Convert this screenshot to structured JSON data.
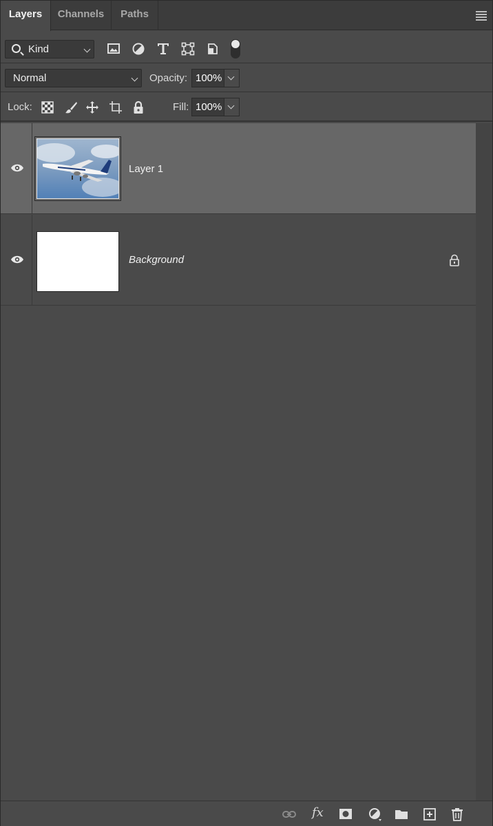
{
  "tabs": [
    {
      "label": "Layers",
      "active": true
    },
    {
      "label": "Channels",
      "active": false
    },
    {
      "label": "Paths",
      "active": false
    }
  ],
  "filter": {
    "kind_label": "Kind",
    "icons": [
      "image-filter-icon",
      "adjustment-filter-icon",
      "type-filter-icon",
      "shape-filter-icon",
      "smart-object-filter-icon",
      "filter-toggle"
    ]
  },
  "blend": {
    "mode": "Normal",
    "opacity_label": "Opacity:",
    "opacity_value": "100%"
  },
  "lock": {
    "label": "Lock:",
    "icons": [
      "lock-transparent-icon",
      "lock-image-icon",
      "lock-position-icon",
      "lock-artboard-icon",
      "lock-all-icon"
    ],
    "fill_label": "Fill:",
    "fill_value": "100%"
  },
  "layers": [
    {
      "name": "Layer 1",
      "selected": true,
      "visible": true,
      "locked": false,
      "thumbnail": "airplane"
    },
    {
      "name": "Background",
      "selected": false,
      "visible": true,
      "locked": true,
      "thumbnail": "white"
    }
  ],
  "bottom_icons": [
    "link-icon",
    "fx-icon",
    "mask-icon",
    "adjustment-icon",
    "group-folder-icon",
    "new-layer-icon",
    "trash-icon"
  ],
  "fx_label": "fx",
  "colors": {
    "panel_bg": "#4a4a4a",
    "selected_row": "#676767",
    "tab_bar": "#3c3c3c"
  }
}
